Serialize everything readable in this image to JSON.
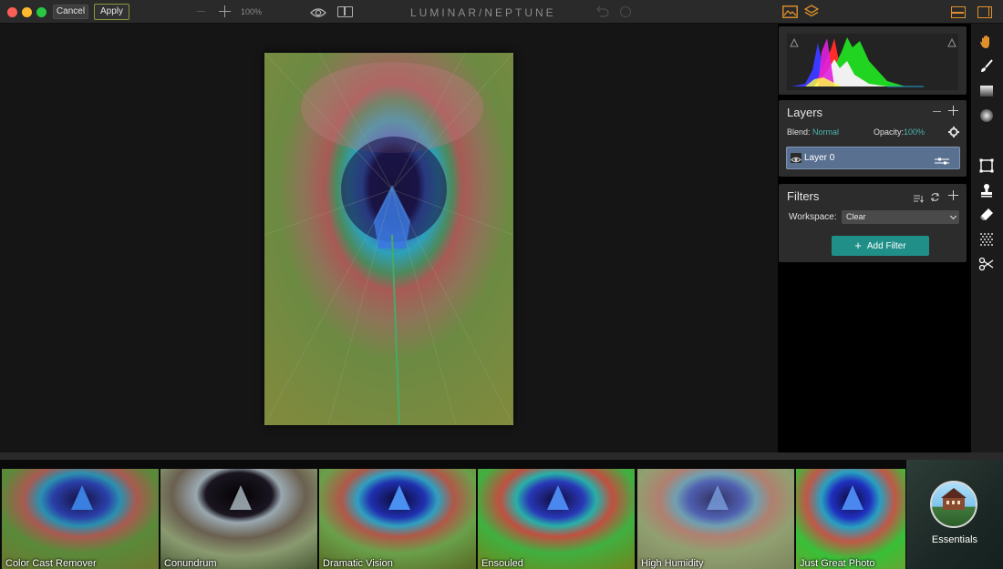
{
  "toolbar": {
    "cancel_label": "Cancel",
    "apply_label": "Apply",
    "zoom_level": "100%",
    "app_title": "LUMINAR/NEPTUNE"
  },
  "layers": {
    "title": "Layers",
    "blend_label": "Blend:",
    "blend_value": "Normal",
    "opacity_label": "Opacity:",
    "opacity_value": "100%",
    "layer_name": "Layer 0"
  },
  "filters": {
    "title": "Filters",
    "workspace_label": "Workspace:",
    "workspace_value": "Clear",
    "add_filter_label": "Add Filter"
  },
  "tools": [
    "hand-icon",
    "brush-icon",
    "gradient-icon",
    "radial-icon",
    "crop-icon",
    "stamp-icon",
    "eraser-icon",
    "noise-icon",
    "scissors-icon"
  ],
  "presets": [
    {
      "label": "Color Cast Remover"
    },
    {
      "label": "Conundrum"
    },
    {
      "label": "Dramatic Vision"
    },
    {
      "label": "Ensouled"
    },
    {
      "label": "High Humidity"
    },
    {
      "label": "Just Great Photo"
    }
  ],
  "preset_category": "Essentials",
  "colors": {
    "accent": "#e0902a",
    "teal": "#1f8f88",
    "layer_selected": "#5a7090"
  }
}
